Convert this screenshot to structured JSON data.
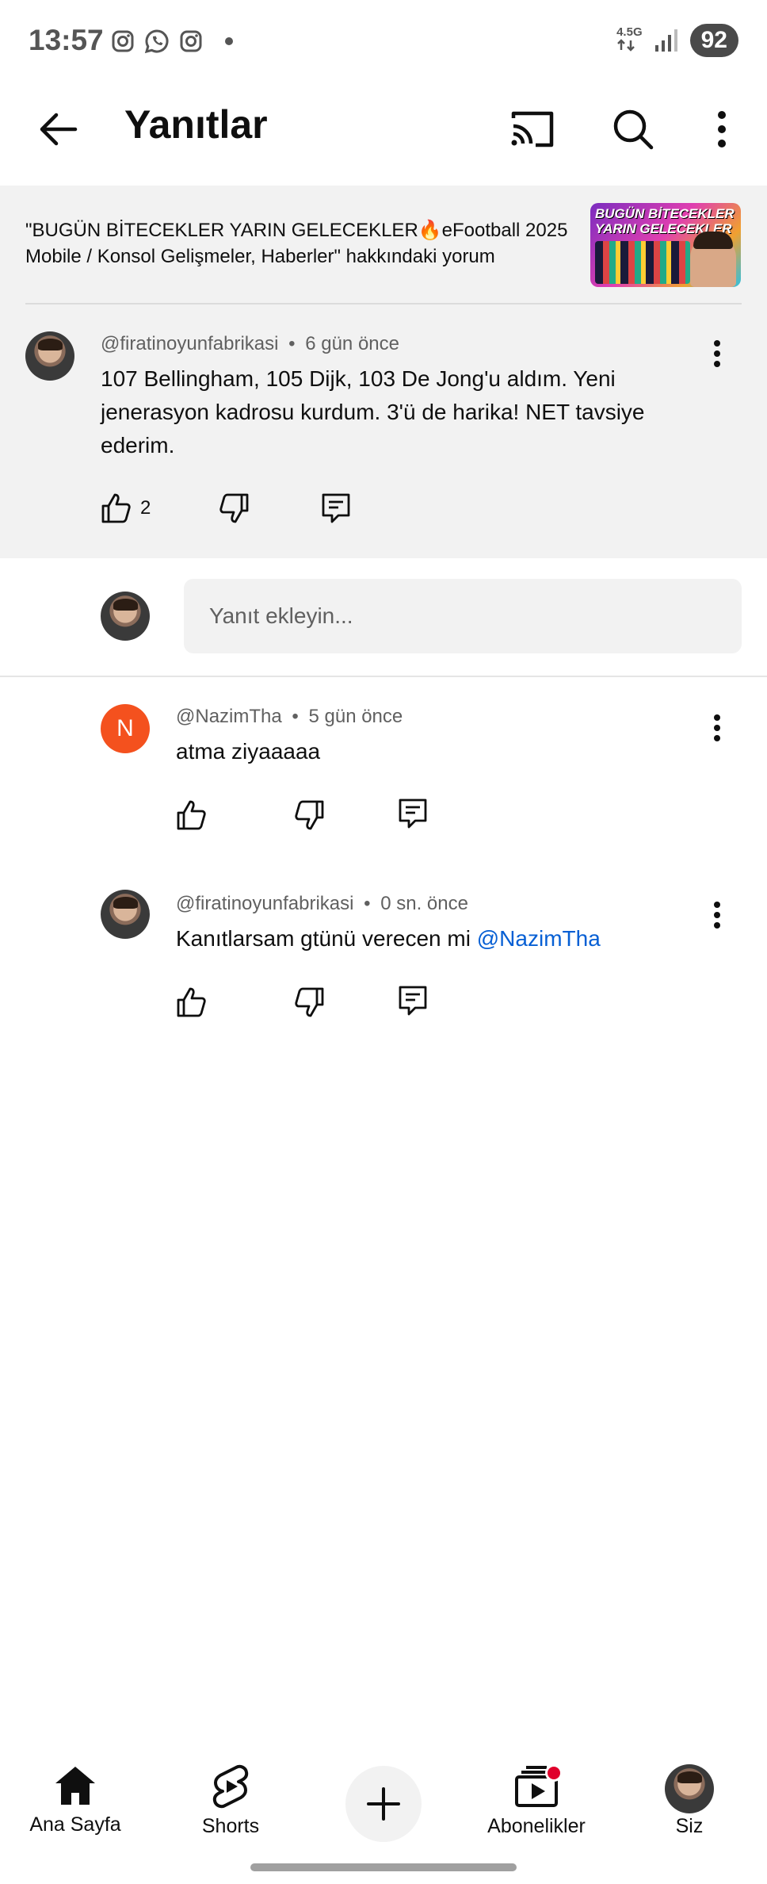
{
  "status_bar": {
    "time": "13:57",
    "network": "4.5G",
    "battery": "92"
  },
  "app_bar": {
    "title": "Yanıtlar"
  },
  "video": {
    "comment_context": "\"BUGÜN BİTECEKLER YARIN GELECEKLER🔥eFootball 2025 Mobile / Konsol Gelişmeler, Haberler\" hakkındaki yorum",
    "thumbnail_text": "BUGÜN BİTECEKLER YARIN GELECEKLER"
  },
  "parent_comment": {
    "author": "@firatinoyunfabrikasi",
    "time": "6 gün önce",
    "text": "107 Bellingham, 105 Dijk, 103 De Jong'u aldım. Yeni jenerasyon kadrosu kurdum. 3'ü de harika! NET tavsiye ederim.",
    "likes": "2"
  },
  "reply_input": {
    "placeholder": "Yanıt ekleyin..."
  },
  "replies": [
    {
      "avatar_letter": "N",
      "author": "@NazimTha",
      "time": "5 gün önce",
      "text": "atma ziyaaaaa"
    },
    {
      "author": "@firatinoyunfabrikasi",
      "time": "0 sn. önce",
      "text": "Kanıtlarsam gtünü verecen mi ",
      "mention": "@NazimTha"
    }
  ],
  "meta_separator": "•",
  "bottom_nav": {
    "home": "Ana Sayfa",
    "shorts": "Shorts",
    "subscriptions": "Abonelikler",
    "you": "Siz"
  },
  "colors": {
    "accent_red": "#e0002b",
    "mention_blue": "#065fd4",
    "avatar_orange": "#f4511e",
    "header_bg": "#f2f2f2"
  }
}
